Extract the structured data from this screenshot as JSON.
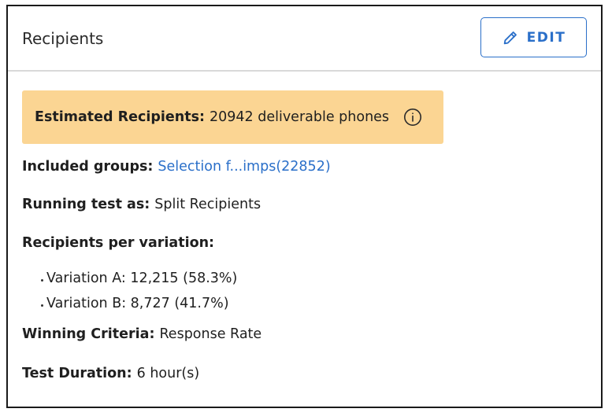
{
  "header": {
    "title": "Recipients",
    "edit_label": "EDIT"
  },
  "estimate": {
    "label": "Estimated Recipients:",
    "value": "20942 deliverable phones",
    "info_icon": "info-circle-icon"
  },
  "groups": {
    "label": "Included groups:",
    "link_text": "Selection f...imps(22852)"
  },
  "test_mode": {
    "label": "Running test as:",
    "value": "Split Recipients"
  },
  "per_variation": {
    "label": "Recipients per variation:",
    "items": [
      "Variation A: 12,215 (58.3%)",
      "Variation B: 8,727 (41.7%)"
    ]
  },
  "criteria": {
    "label": "Winning Criteria:",
    "value": "Response Rate"
  },
  "duration": {
    "label": "Test Duration:",
    "value": "6 hour(s)"
  },
  "colors": {
    "accent": "#2a6fc9",
    "highlight_bg": "#fbd593",
    "border": "#1a1a1a",
    "divider": "#d9d9d9"
  }
}
